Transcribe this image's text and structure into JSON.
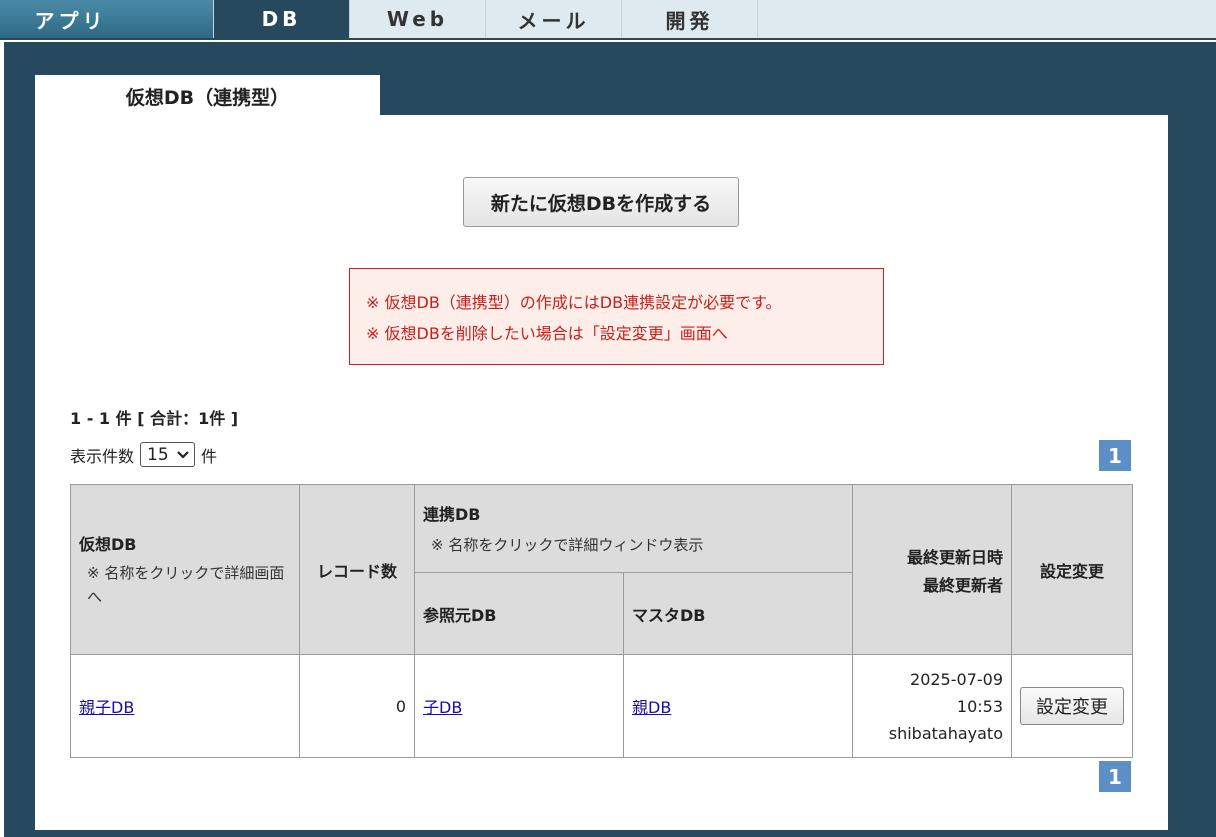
{
  "topnav": {
    "tabs": [
      {
        "label": "アプリ"
      },
      {
        "label": "DB"
      },
      {
        "label": "Web"
      },
      {
        "label": "メール"
      },
      {
        "label": "開発"
      }
    ]
  },
  "page": {
    "tab_title": "仮想DB（連携型）",
    "create_button": "新たに仮想DBを作成する",
    "notice": [
      "※ 仮想DB（連携型）の作成にはDB連携設定が必要です。",
      "※ 仮想DBを削除したい場合は「設定変更」画面へ"
    ],
    "count_text": "1 - 1 件 [ 合計：1件 ]",
    "per_page_label": "表示件数",
    "per_page_value": "15",
    "per_page_unit": "件",
    "page_number": "1"
  },
  "table": {
    "headers": {
      "virtual_db": "仮想DB",
      "virtual_db_note": "※ 名称をクリックで詳細画面へ",
      "records": "レコード数",
      "linked_db": "連携DB",
      "linked_db_note": "※ 名称をクリックで詳細ウィンドウ表示",
      "source_db": "参照元DB",
      "master_db": "マスタDB",
      "updated_line1": "最終更新日時",
      "updated_line2": "最終更新者",
      "settings": "設定変更"
    },
    "rows": [
      {
        "virtual_db": "親子DB",
        "records": "0",
        "source_db": "子DB",
        "master_db": "親DB",
        "updated_date": "2025-07-09",
        "updated_time": "10:53",
        "updated_by": "shibatahayato",
        "settings_button": "設定変更"
      }
    ]
  }
}
